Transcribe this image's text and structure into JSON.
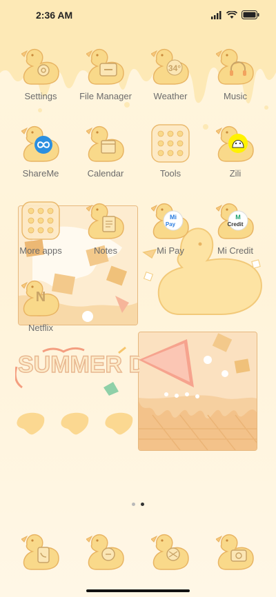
{
  "status_bar": {
    "time": "2:36 AM",
    "icons": [
      "signal-icon",
      "wifi-icon",
      "battery-icon"
    ]
  },
  "apps": [
    {
      "name": "settings",
      "label": "Settings",
      "icon": "gear-icon"
    },
    {
      "name": "file-manager",
      "label": "File Manager",
      "icon": "folder-icon"
    },
    {
      "name": "weather",
      "label": "Weather",
      "icon": "weather-icon",
      "glyph_text": "34°"
    },
    {
      "name": "music",
      "label": "Music",
      "icon": "headphones-icon"
    },
    {
      "name": "shareme",
      "label": "ShareMe",
      "icon": "infinity-icon"
    },
    {
      "name": "calendar",
      "label": "Calendar",
      "icon": "calendar-icon"
    },
    {
      "name": "tools",
      "label": "Tools",
      "icon": "folder-grid-icon"
    },
    {
      "name": "zili",
      "label": "Zili",
      "icon": "smiley-icon"
    },
    {
      "name": "more-apps",
      "label": "More apps",
      "icon": "folder-grid-icon"
    },
    {
      "name": "notes",
      "label": "Notes",
      "icon": "notes-icon"
    },
    {
      "name": "mi-pay",
      "label": "Mi Pay",
      "icon": "mi-pay-icon",
      "glyph_text": "Pay"
    },
    {
      "name": "mi-credit",
      "label": "Mi Credit",
      "icon": "mi-credit-icon",
      "glyph_text": "Credit"
    },
    {
      "name": "netflix",
      "label": "Netflix",
      "icon": "netflix-icon",
      "glyph_text": "N"
    }
  ],
  "dock": [
    {
      "name": "phone",
      "icon": "phone-icon"
    },
    {
      "name": "messages",
      "icon": "message-icon"
    },
    {
      "name": "browser",
      "icon": "browser-icon"
    },
    {
      "name": "camera",
      "icon": "camera-icon"
    }
  ],
  "widget": {
    "summer_text": "SUMMER DAY"
  },
  "pagination": {
    "current": 2,
    "total": 2
  },
  "colors": {
    "background": "#fff6df",
    "duck": "#f9d98a",
    "duck_outline": "#e8b463",
    "drip": "#fde9b6",
    "label": "#6b6b6b",
    "accent_orange": "#f2a35e"
  }
}
